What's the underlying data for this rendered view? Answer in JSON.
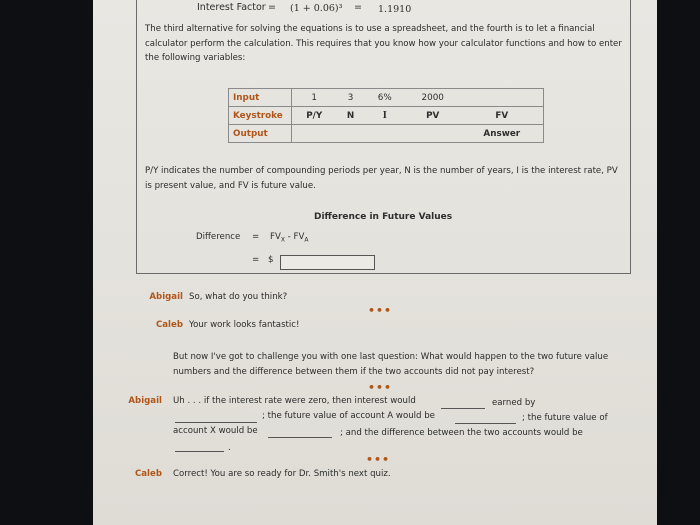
{
  "equation": {
    "label": "Interest Factor",
    "eq1": "=",
    "expr": "(1 + 0.06)³",
    "eq2": "=",
    "result": "1.1910"
  },
  "intro_paragraph": "The third alternative for solving the equations is to use a spreadsheet, and the fourth is to let a financial calculator perform the calculation. This requires that you know how your calculator functions and how to enter the following variables:",
  "calc_table": {
    "rows": [
      {
        "label": "Input",
        "cells": [
          "1",
          "3",
          "6%",
          "2000",
          ""
        ]
      },
      {
        "label": "Keystroke",
        "cells": [
          "P/Y",
          "N",
          "I",
          "PV",
          "FV"
        ]
      },
      {
        "label": "Output",
        "cells": [
          "",
          "",
          "",
          "",
          "Answer"
        ]
      }
    ]
  },
  "definitions_paragraph": "P/Y indicates the number of compounding periods per year, N is the number of years, I is the interest rate, PV is present value, and FV is future value.",
  "difference_section": {
    "title": "Difference in Future Values",
    "label": "Difference",
    "eq": "=",
    "formula_fv": "FV",
    "formula_x": "X",
    "formula_minus": " - FV",
    "formula_a": "A",
    "eq2": "=",
    "currency": "$",
    "input_value": ""
  },
  "dialogue": {
    "dots": "•••",
    "line1": {
      "speaker": "Abigail",
      "text": "So, what do you think?"
    },
    "line2": {
      "speaker": "Caleb",
      "text": "Your work looks fantastic!"
    },
    "caleb_question": "But now I've got to challenge you with one last question: What would happen to the two future value numbers and the difference between them if the two accounts did not pay interest?",
    "line3": {
      "speaker": "Abigail",
      "part1": "Uh . . . if the interest rate were zero, then interest would",
      "part2": "earned by",
      "part3": "; the future value of account A would be",
      "part4": "; the future value of",
      "part5": "account X would be",
      "part6": "; and the difference between the two accounts would be",
      "part7": ".",
      "blanks": [
        "",
        "",
        "",
        "",
        ""
      ]
    },
    "line4": {
      "speaker": "Caleb",
      "text": "Correct! You are so ready for Dr. Smith's next quiz."
    }
  }
}
